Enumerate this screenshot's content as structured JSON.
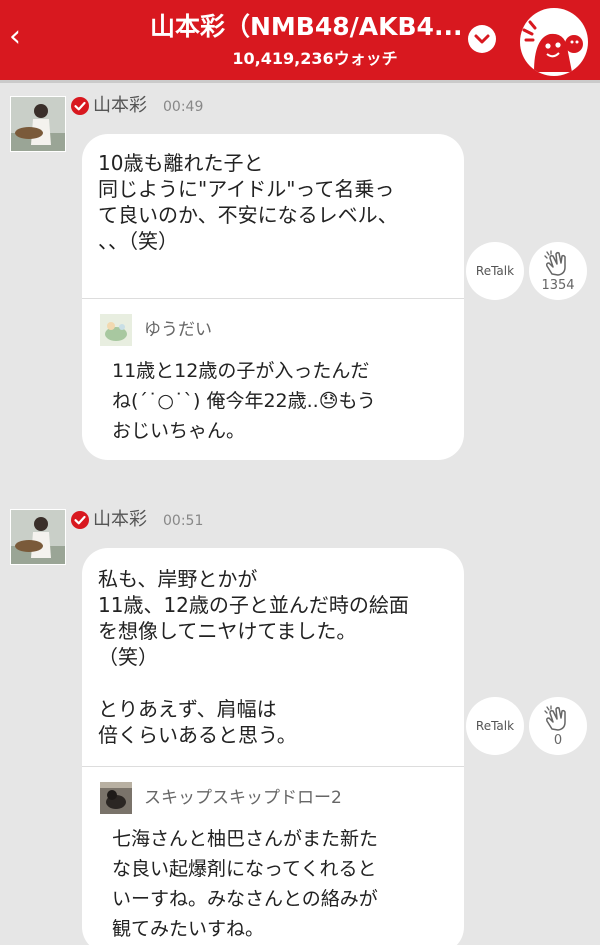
{
  "header": {
    "back_glyph": "‹",
    "title": "山本彩（NMB48/AKB4...",
    "watch_count": "10,419,236ウォッチ",
    "dropdown_icon": "chevron-down-icon",
    "mascot_icon": "mascot-icon",
    "brand_color": "#d8181f"
  },
  "posts": [
    {
      "author": "山本彩",
      "time": "00:49",
      "message": "10歳も離れた子と\n同じように\"アイドル\"って名乗っ\nて良いのか、不安になるレベル、\n、、（笑）",
      "retalk_label": "ReTalk",
      "clap_count": "1354",
      "reply": {
        "author": "ゆうだい",
        "message": "11歳と12歳の子が入ったんだ\nね(´˙○˙`) 俺今年22歳..😓もう\nおじいちゃん。"
      }
    },
    {
      "author": "山本彩",
      "time": "00:51",
      "message": "私も、岸野とかが\n11歳、12歳の子と並んだ時の絵面\nを想像してニヤけてました。\n（笑）\n\nとりあえず、肩幅は\n倍くらいあると思う。",
      "retalk_label": "ReTalk",
      "clap_count": "0",
      "reply": {
        "author": "スキップスキップドロー2",
        "message": "七海さんと柚巴さんがまた新た\nな良い起爆剤になってくれると\nいーすね。みなさんとの絡みが\n観てみたいすね。"
      }
    }
  ]
}
